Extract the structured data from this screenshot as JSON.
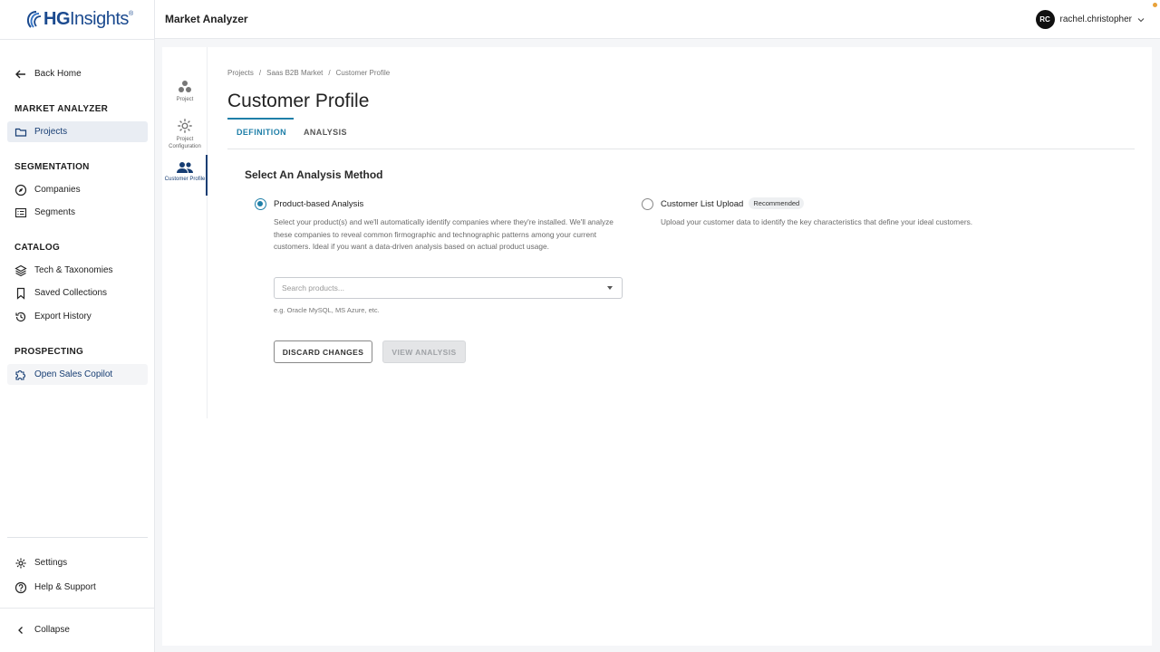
{
  "brand": {
    "logo_main": "HG",
    "logo_light": "Insights",
    "logo_tm": "®"
  },
  "topbar": {
    "title": "Market Analyzer",
    "user_initials": "RC",
    "user_name": "rachel.christopher"
  },
  "sidebar": {
    "back_home": "Back Home",
    "sections": [
      {
        "heading": "MARKET ANALYZER",
        "items": [
          {
            "label": "Projects",
            "icon": "folder-icon"
          }
        ]
      },
      {
        "heading": "SEGMENTATION",
        "items": [
          {
            "label": "Companies",
            "icon": "compass-icon"
          },
          {
            "label": "Segments",
            "icon": "list-icon"
          }
        ]
      },
      {
        "heading": "CATALOG",
        "items": [
          {
            "label": "Tech & Taxonomies",
            "icon": "layers-icon"
          },
          {
            "label": "Saved Collections",
            "icon": "bookmark-icon"
          },
          {
            "label": "Export History",
            "icon": "history-icon"
          }
        ]
      },
      {
        "heading": "PROSPECTING",
        "items": [
          {
            "label": "Open Sales Copilot",
            "icon": "puzzle-icon"
          }
        ]
      }
    ],
    "settings": "Settings",
    "help": "Help & Support",
    "collapse": "Collapse"
  },
  "rail": [
    {
      "label": "Project",
      "icon": "project-icon"
    },
    {
      "label": "Project Configuration",
      "icon": "gear-icon"
    },
    {
      "label": "Customer Profile",
      "icon": "people-icon"
    }
  ],
  "breadcrumb": [
    "Projects",
    "Saas B2B Market",
    "Customer Profile"
  ],
  "page_title": "Customer Profile",
  "tabs": [
    "DEFINITION",
    "ANALYSIS"
  ],
  "section_title": "Select An Analysis Method",
  "options": [
    {
      "label": "Product-based Analysis",
      "description": "Select your product(s) and we'll automatically identify companies where they're installed. We'll analyze these companies to reveal common firmographic and technographic patterns among your current customers. Ideal if you want a data-driven analysis based on actual product usage.",
      "selected": true
    },
    {
      "label": "Customer List Upload",
      "badge": "Recommended",
      "description": "Upload your customer data to identify the key characteristics that define your ideal customers.",
      "selected": false
    }
  ],
  "search": {
    "placeholder": "Search products...",
    "value": ""
  },
  "hint": "e.g. Oracle MySQL, MS Azure, etc.",
  "buttons": {
    "discard": "DISCARD CHANGES",
    "view": "VIEW ANALYSIS"
  },
  "colors": {
    "accent": "#1f7fa8",
    "brand": "#1b4a8f",
    "nav_active": "#163d73"
  }
}
